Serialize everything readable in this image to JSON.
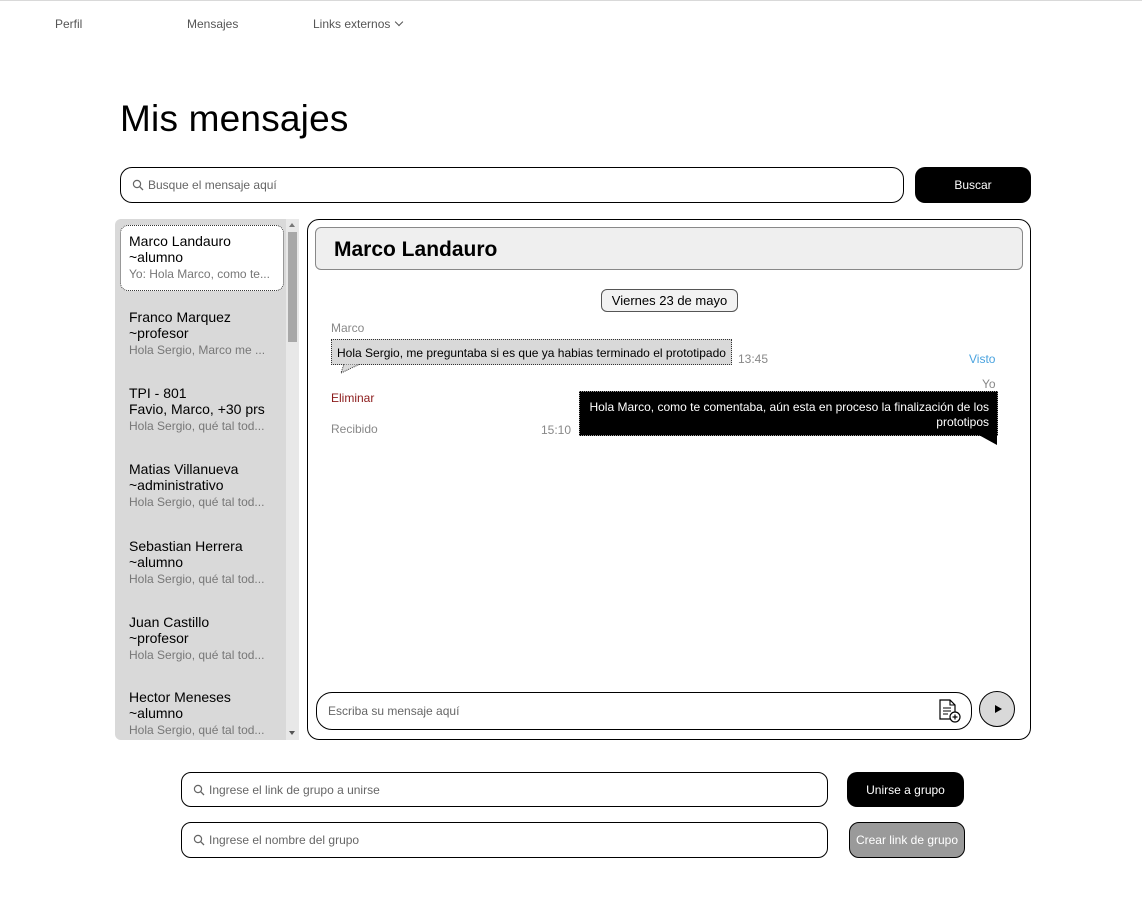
{
  "nav": {
    "items": [
      {
        "label": "Perfil"
      },
      {
        "label": "Mensajes"
      },
      {
        "label": "Links externos"
      }
    ]
  },
  "page_title": "Mis mensajes",
  "search": {
    "placeholder": "Busque el mensaje aquí",
    "button_label": "Buscar"
  },
  "conversations": [
    {
      "name": "Marco Landauro",
      "role": "~alumno",
      "preview": "Yo: Hola Marco, como te...",
      "active": true
    },
    {
      "name": "Franco Marquez",
      "role": "~profesor",
      "preview": "Hola Sergio, Marco me ...",
      "active": false
    },
    {
      "name": "TPI - 801",
      "role": "Favio, Marco, +30 prs",
      "preview": "Hola Sergio, qué tal tod...",
      "active": false
    },
    {
      "name": "Matias Villanueva",
      "role": "~administrativo",
      "preview": "Hola Sergio, qué tal tod...",
      "active": false
    },
    {
      "name": "Sebastian Herrera",
      "role": "~alumno",
      "preview": "Hola Sergio, qué tal tod...",
      "active": false
    },
    {
      "name": "Juan Castillo",
      "role": "~profesor",
      "preview": "Hola Sergio, qué tal tod...",
      "active": false
    },
    {
      "name": "Hector Meneses",
      "role": "~alumno",
      "preview": "Hola Sergio, qué tal tod...",
      "active": false
    }
  ],
  "chat": {
    "contact_name": "Marco Landauro",
    "date_label": "Viernes 23 de mayo",
    "incoming": {
      "sender": "Marco",
      "text": "Hola Sergio, me preguntaba si es que ya habias terminado el prototipado",
      "time": "13:45",
      "status": "Visto",
      "delete_label": "Eliminar"
    },
    "outgoing": {
      "sender": "Yo",
      "text": "Hola Marco, como te comentaba, aún esta en proceso la finalización de los prototipos",
      "time": "15:10",
      "status": "Recibido"
    },
    "compose_placeholder": "Escriba su mensaje aquí"
  },
  "groups": {
    "join_placeholder": "Ingrese el link de grupo a unirse",
    "join_button": "Unirse a grupo",
    "create_placeholder": "Ingrese el nombre del grupo",
    "create_button": "Crear link de grupo"
  },
  "colors": {
    "accent_link": "#4aa3df",
    "delete_text": "#8b1a1a",
    "panel_gray": "#d9d9d9"
  },
  "icons": {
    "search": "magnifier-icon",
    "attach": "attach-file-icon",
    "send": "play-send-icon",
    "dropdown": "chevron-down-icon"
  }
}
